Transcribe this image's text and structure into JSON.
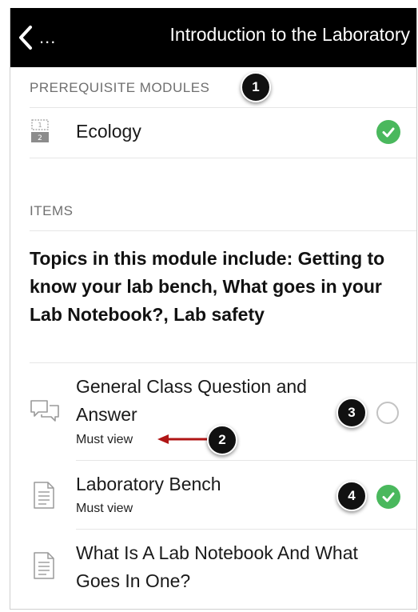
{
  "navbar": {
    "back_label": "...",
    "title": "Introduction to the Laboratory"
  },
  "prerequisites": {
    "header": "PREREQUISITE MODULES",
    "items": [
      {
        "label": "Ecology",
        "icon": "module-icon",
        "status": "completed"
      }
    ]
  },
  "items_section": {
    "header": "ITEMS",
    "description": "Topics in this module include: Getting to know your lab bench, What goes in your Lab Notebook?, Lab safety",
    "items": [
      {
        "title": "General Class Question and Answer",
        "requirement": "Must view",
        "icon": "discussion-icon",
        "status": "incomplete"
      },
      {
        "title": "Laboratory Bench",
        "requirement": "Must view",
        "icon": "page-icon",
        "status": "completed"
      },
      {
        "title": "What Is A Lab Notebook And What Goes In One?",
        "icon": "page-icon"
      }
    ]
  },
  "callouts": [
    "1",
    "2",
    "3",
    "4"
  ],
  "colors": {
    "navbar": "#000000",
    "check": "#4ab85d",
    "arrow": "#b01515",
    "section_header": "#6f6f6f"
  }
}
